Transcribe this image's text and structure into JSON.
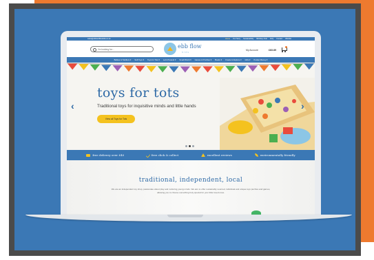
{
  "topbar": {
    "email": "sales@ebbandflowkids.co.uk",
    "links": [
      "Home",
      "Our Story",
      "Sustainability",
      "Birthday Club",
      "FAQ",
      "Contact",
      "Wishlist"
    ]
  },
  "header": {
    "search_placeholder": "I'm looking for...",
    "logo_name": "ebb flow",
    "logo_tag": "kids",
    "account_label": "My Account",
    "basket_total": "£83.89"
  },
  "nav": {
    "items": [
      "Babies & Toddlers ▾",
      "Soft Toys ▾",
      "Toys for Tots ▾",
      "Let's Pretend ▾",
      "Small World ▾",
      "Games & Puzzles ▾",
      "Books ▾",
      "Create & Explore ▾",
      "Gifts ▾",
      "Pocket Money ▾"
    ]
  },
  "hero": {
    "title": "toys for tots",
    "subtitle": "Traditional toys for inquisitive minds and little hands",
    "button": "View all Toys for Tots",
    "bunting_colors": [
      "#e94b3c",
      "#f4c21f",
      "#4caf50",
      "#3b78b5",
      "#9c5fb5",
      "#ee7a2f",
      "#e94b3c",
      "#f4c21f",
      "#4caf50",
      "#3b78b5",
      "#9c5fb5",
      "#ee7a2f",
      "#e94b3c",
      "#f4c21f",
      "#4caf50",
      "#3b78b5",
      "#9c5fb5",
      "#ee7a2f",
      "#e94b3c",
      "#f4c21f",
      "#4caf50",
      "#3b78b5"
    ]
  },
  "features": [
    {
      "icon": "truck-icon",
      "label": "free delivery over £40"
    },
    {
      "icon": "check-icon",
      "label": "free click & collect"
    },
    {
      "icon": "star-icon",
      "label": "excellent reviews"
    },
    {
      "icon": "leaf-icon",
      "label": "environmentally friendly"
    }
  ],
  "intro": {
    "title": "traditional, independent, local",
    "text": "We are an independent toy shop, passionate about play and nurturing young minds. We aim to offer sustainably sourced, individual and unique toys puzzles and games, allowing you to choose something truly special for your little loved ones."
  },
  "colors": {
    "accent_blue": "#3b78b5",
    "accent_orange": "#ee7a2f",
    "accent_yellow": "#f4c21f",
    "frame": "#4b4b4b"
  }
}
